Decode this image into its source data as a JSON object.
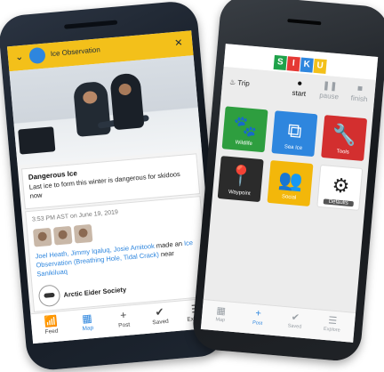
{
  "android": {
    "header": {
      "title": "Ice Observation"
    },
    "card": {
      "heading": "Dangerous Ice",
      "body": "Last ice to form this winter is dangerous for skidoos now"
    },
    "post": {
      "timestamp": "3:53 PM AST on June 19, 2019",
      "people": "Joel Heath, Jimmy Iqaluq, Josie Amitook",
      "made_prefix": " made an ",
      "observation": "Ice Observation (Breathing Hole, Tidal Crack)",
      "near": " near ",
      "place": "Sanikiluaq",
      "organization": "Arctic Eider Society"
    },
    "nav": [
      {
        "label": "Feed",
        "icon": "feed-icon"
      },
      {
        "label": "Map",
        "icon": "map-icon",
        "selected": true
      },
      {
        "label": "Post",
        "icon": "plus-icon"
      },
      {
        "label": "Saved",
        "icon": "check-icon"
      },
      {
        "label": "Explore",
        "icon": "menu-icon"
      }
    ]
  },
  "iphone": {
    "logo_letters": [
      "S",
      "I",
      "K",
      "U"
    ],
    "logo_colors": [
      "#1fa24a",
      "#e53935",
      "#2e86de",
      "#f3c01a"
    ],
    "trip": {
      "label": "Trip",
      "start": "start",
      "pause": "pause",
      "finish": "finish"
    },
    "tiles": [
      {
        "label": "Wildlife",
        "icon": "paw-icon",
        "color": "#2e9e3f"
      },
      {
        "label": "Sea Ice",
        "icon": "ice-cubes-icon",
        "color": "#2e86de"
      },
      {
        "label": "Tools",
        "icon": "wrench-icon",
        "color": "#d32f2f"
      },
      {
        "label": "Waypoint",
        "icon": "location-pin-icon",
        "color": "#2b2b2b"
      },
      {
        "label": "Social",
        "icon": "people-icon",
        "color": "#f3b70a"
      },
      {
        "label": "Defaults",
        "icon": "gear-icon",
        "color": "#ffffff"
      }
    ],
    "nav": [
      {
        "label": "Map",
        "icon": "map-icon"
      },
      {
        "label": "Post",
        "icon": "plus-icon",
        "selected": true
      },
      {
        "label": "Saved",
        "icon": "check-icon"
      },
      {
        "label": "Explore",
        "icon": "menu-icon"
      }
    ]
  }
}
